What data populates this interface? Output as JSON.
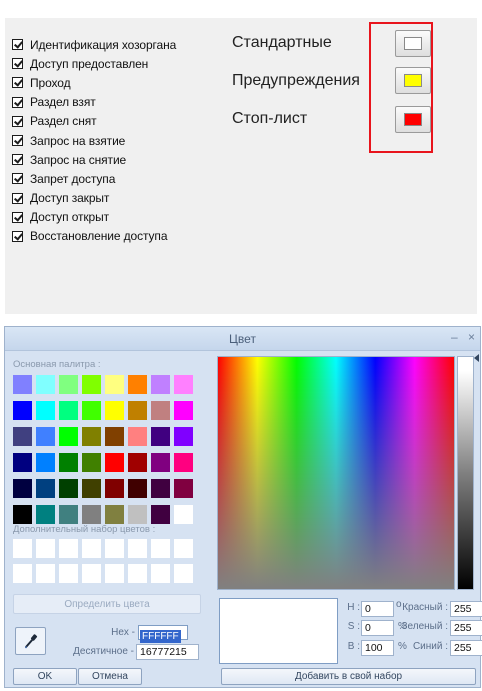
{
  "status_options": [
    "Идентификация хозоргана",
    "Доступ предоставлен",
    "Проход",
    "Раздел взят",
    "Раздел снят",
    "Запрос на взятие",
    "Запрос на снятие",
    "Запрет доступа",
    "Доступ закрыт",
    "Доступ открыт",
    "Восстановление доступа"
  ],
  "categories": [
    {
      "label": "Стандартные",
      "color": "#ffffff"
    },
    {
      "label": "Предупреждения",
      "color": "#ffff00"
    },
    {
      "label": "Стоп-лист",
      "color": "#ff0000"
    }
  ],
  "dialog": {
    "title": "Цвет",
    "minimize_glyph": "–",
    "close_glyph": "×",
    "basic_palette_label": "Основная палитра :",
    "basic_colors": [
      "#8080ff",
      "#80ffff",
      "#80ff80",
      "#80ff00",
      "#ffff80",
      "#ff8000",
      "#c080ff",
      "#ff80ff",
      "#0000ff",
      "#00ffff",
      "#00ff80",
      "#40ff00",
      "#ffff00",
      "#c08000",
      "#c08080",
      "#ff00ff",
      "#404080",
      "#4080ff",
      "#00ff00",
      "#808000",
      "#804000",
      "#ff8080",
      "#400080",
      "#8000ff",
      "#000080",
      "#0080ff",
      "#008000",
      "#408000",
      "#ff0000",
      "#a00000",
      "#800080",
      "#ff0080",
      "#000040",
      "#004080",
      "#004000",
      "#404000",
      "#800000",
      "#400000",
      "#400040",
      "#800040",
      "#000000",
      "#008080",
      "#408080",
      "#808080",
      "#808040",
      "#c0c0c0",
      "#400040",
      "#ffffff"
    ],
    "custom_palette_label": "Дополнительный набор цветов :",
    "custom_colors": [
      "#ffffff",
      "#ffffff",
      "#ffffff",
      "#ffffff",
      "#ffffff",
      "#ffffff",
      "#ffffff",
      "#ffffff",
      "#ffffff",
      "#ffffff",
      "#ffffff",
      "#ffffff",
      "#ffffff",
      "#ffffff",
      "#ffffff",
      "#ffffff"
    ],
    "define_colors_label": "Определить цвета",
    "hex_label": "Hex -",
    "hex_value": "FFFFFF",
    "decimal_label": "Десятичное -",
    "decimal_value": "16777215",
    "ok_label": "OK",
    "cancel_label": "Отмена",
    "h_label": "H :",
    "h_value": "0",
    "s_label": "S :",
    "s_value": "0",
    "b_label": "B :",
    "b_value": "100",
    "degree_unit": "o",
    "percent_unit_s": "%",
    "percent_unit_b": "%",
    "red_label": "Красный :",
    "red_value": "255",
    "green_label": "Зеленый :",
    "green_value": "255",
    "blue_label": "Синий :",
    "blue_value": "255",
    "add_custom_label": "Добавить в свой набор",
    "preview_color": "#ffffff"
  }
}
